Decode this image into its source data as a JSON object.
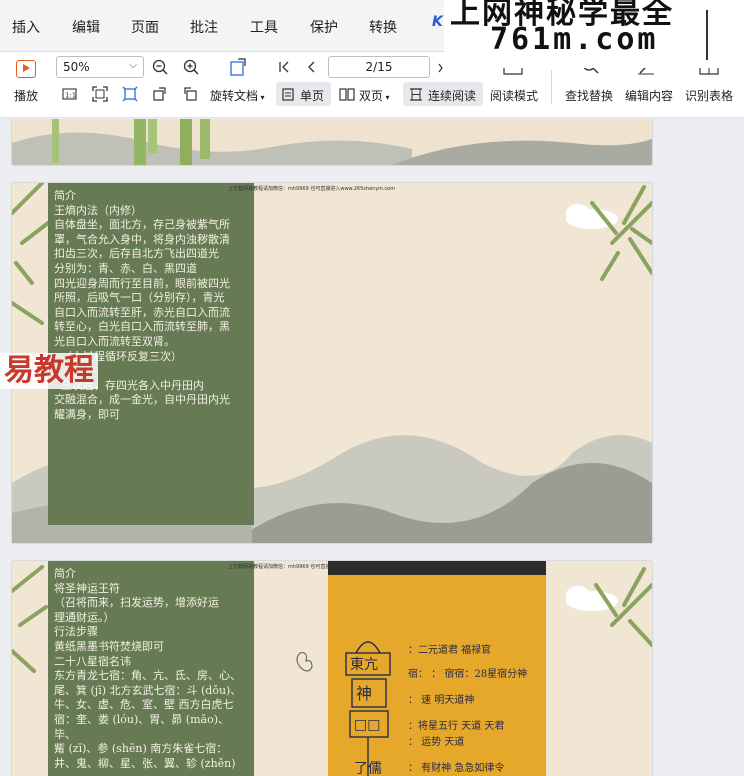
{
  "menu": {
    "items": [
      "插入",
      "编辑",
      "页面",
      "批注",
      "工具",
      "保护",
      "转换"
    ],
    "partial_item": "K"
  },
  "watermark": {
    "line1": "上网神秘学最全",
    "line2": "761m.com"
  },
  "toolbar": {
    "play_label": "播放",
    "zoom_value": "50%",
    "zoom_out_icon": "zoom-out-icon",
    "zoom_in_icon": "zoom-in-icon",
    "page_value": "2/15",
    "rotate_label": "旋转文档",
    "single_page_label": "单页",
    "double_page_label": "双页",
    "continuous_label": "连续阅读",
    "reading_mode_label": "阅读模式",
    "find_replace_label": "查找替换",
    "edit_content_label": "编辑内容",
    "recognize_table_label": "识别表格",
    "accent_color": "#e65a1e"
  },
  "doc": {
    "page2": {
      "header": "上万套网易教程请加微信：mh9969    也可直接进入www.265shenyin.com",
      "body": "简介\n王熵内法（内修）\n自体盘坐，面北方，存己身被紫气所\n罩，气合允入身中，将身内浊秽散清\n扣齿三次，后存自北方飞出四道光\n分别为：青、赤、白、黑四道\n四光迎身周而行至目前，眼前被四光\n所照，后吸气一口（分别存），青光\n自口入而流转至肝，赤光自口入而流\n转至心，白光自口入而流转至肺，黑\n光自口入而流转至双肾。\n  （上过程循环反复三次）\n\n  三次后，存四光各入中丹田内\n交融混合，成一金光，自中丹田内光\n耀满身，即可",
      "overlay": "易教程"
    },
    "page3": {
      "header": "上万套网易教程请加微信：mh9969    也可直接进入www.265shenyin.com",
      "body": "简介\n将圣神运王符\n（召将而来，扫发运势，增添好运\n理通财运。）\n行法步骤\n黄纸黑墨书符焚烧即可\n二十八星宿名讳\n东方青龙七宿：角、亢、氐、房、心、\n尾、箕 (jī) 北方玄武七宿：斗 (dǒu)、\n牛、女、虚、危、室、壁 西方白虎七\n宿：奎、娄 (lóu)、胃、昴 (mǎo)、毕、\n觜 (zī)、参 (shēn) 南方朱雀七宿：\n井、鬼、柳、星、张、翼、轸 (zhěn)",
      "photo_lines": [
        "：二元道君   福禄官",
        "宿：  ：  宿宿：28星宿分神",
        "：  速    明天道神",
        "：将星五行  天道   天君",
        "：    运势    天道",
        "：   有财神  急急如律令"
      ]
    }
  }
}
